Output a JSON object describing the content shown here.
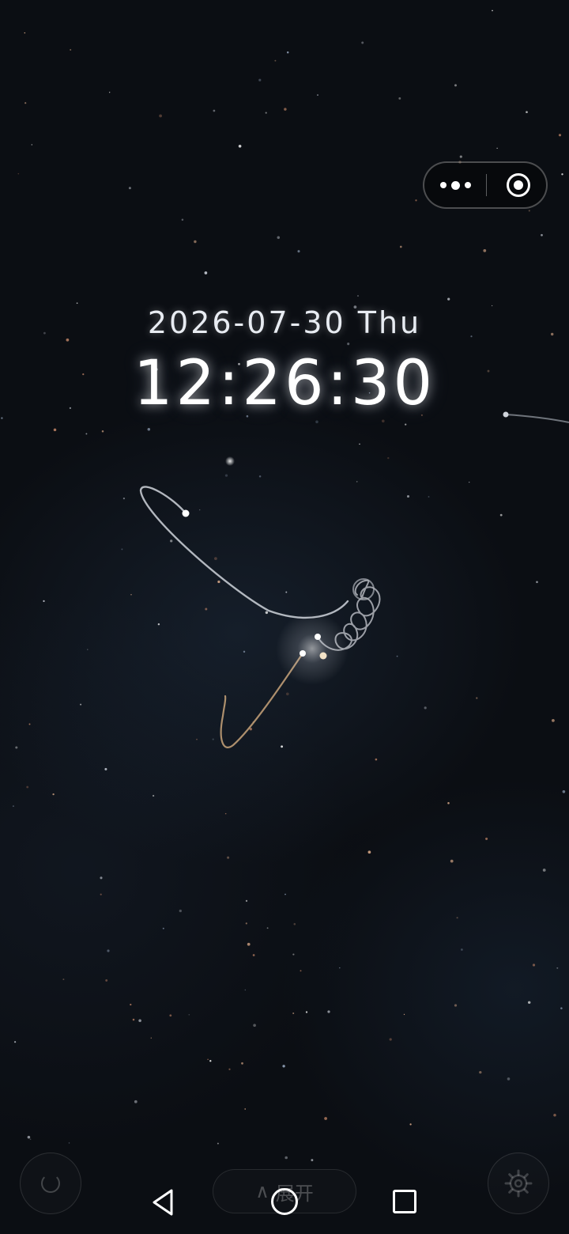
{
  "clock": {
    "date": "2026-07-30 Thu",
    "time": "12:26:30"
  },
  "capsule": {
    "more_icon": "more-dots-icon",
    "close_icon": "target-circle-icon"
  },
  "controls": {
    "refresh_icon": "refresh-icon",
    "expand_arrow": "∧",
    "expand_label": "展开",
    "settings_icon": "settings-gear-icon"
  },
  "system_nav": {
    "back_icon": "back-triangle-icon",
    "home_icon": "home-circle-icon",
    "recent_icon": "recent-square-icon"
  },
  "colors": {
    "background": "#0b0e13",
    "trail_white": "#d9dde3",
    "trail_gold": "#c9a57a",
    "text": "#ffffff"
  }
}
